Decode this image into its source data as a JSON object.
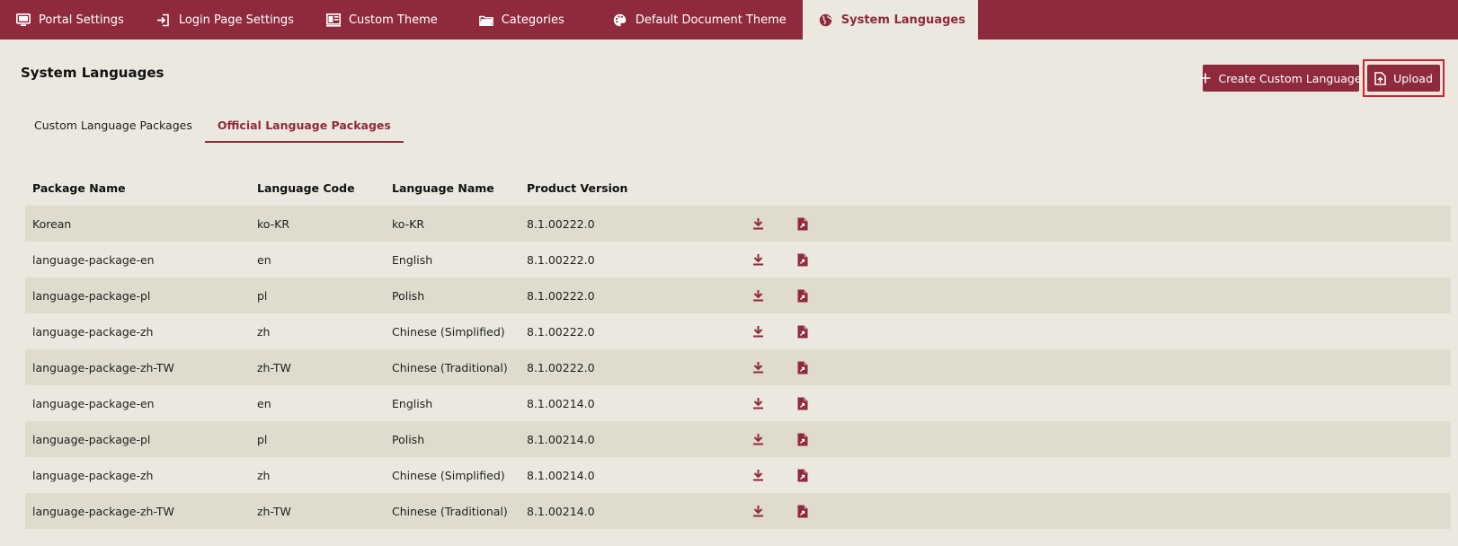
{
  "top_tabs": [
    {
      "label": "Portal Settings",
      "icon": "monitor-icon"
    },
    {
      "label": "Login Page Settings",
      "icon": "login-icon"
    },
    {
      "label": "Custom Theme",
      "icon": "theme-icon"
    },
    {
      "label": "Categories",
      "icon": "folder-icon"
    },
    {
      "label": "Default Document Theme",
      "icon": "palette-icon"
    },
    {
      "label": "System Languages",
      "icon": "globe-icon",
      "active": true
    }
  ],
  "page": {
    "title": "System Languages",
    "create_label": "Create Custom Language",
    "upload_label": "Upload"
  },
  "sub_tabs": [
    {
      "label": "Custom Language Packages"
    },
    {
      "label": "Official Language Packages",
      "active": true
    }
  ],
  "table": {
    "headers": [
      "Package Name",
      "Language Code",
      "Language Name",
      "Product Version"
    ],
    "rows": [
      [
        "Korean",
        "ko-KR",
        "ko-KR",
        "8.1.00222.0"
      ],
      [
        "language-package-en",
        "en",
        "English",
        "8.1.00222.0"
      ],
      [
        "language-package-pl",
        "pl",
        "Polish",
        "8.1.00222.0"
      ],
      [
        "language-package-zh",
        "zh",
        "Chinese (Simplified)",
        "8.1.00222.0"
      ],
      [
        "language-package-zh-TW",
        "zh-TW",
        "Chinese (Traditional)",
        "8.1.00222.0"
      ],
      [
        "language-package-en",
        "en",
        "English",
        "8.1.00214.0"
      ],
      [
        "language-package-pl",
        "pl",
        "Polish",
        "8.1.00214.0"
      ],
      [
        "language-package-zh",
        "zh",
        "Chinese (Simplified)",
        "8.1.00214.0"
      ],
      [
        "language-package-zh-TW",
        "zh-TW",
        "Chinese (Traditional)",
        "8.1.00214.0"
      ]
    ],
    "row_actions": [
      "download-icon",
      "export-file-icon"
    ]
  },
  "colors": {
    "accent": "#8f2a3d",
    "background": "#ebe8df",
    "row_alt": "#dfdbcd",
    "highlight": "#d81e2a"
  }
}
